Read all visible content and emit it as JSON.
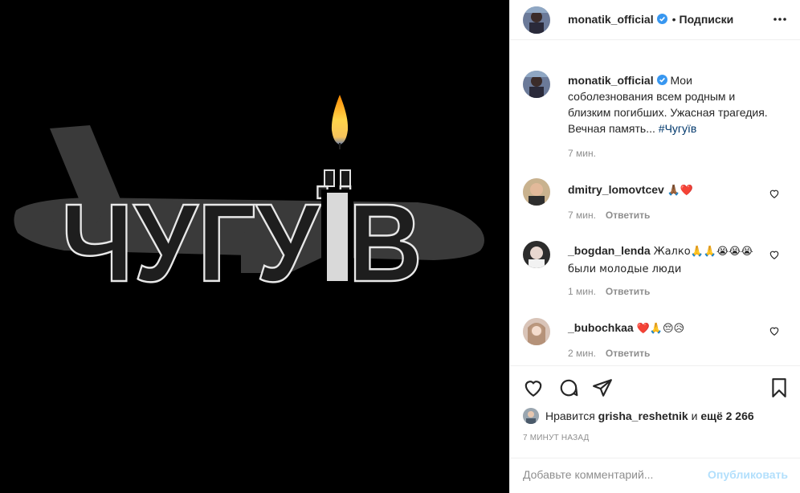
{
  "post": {
    "image_text": "ЧУГУЇВ",
    "author": "monatik_official",
    "follow_dot": "•",
    "follow_label": "Подписки",
    "caption": "Мои соболезнования всем родным и близким погибших. Ужасная трагедия. Вечная память...",
    "caption_hashtag": "#Чугуїв",
    "caption_time": "7 мин."
  },
  "comments": [
    {
      "user": "dmitry_lomovtcev",
      "text": "🙏🏾❤️",
      "time": "7 мин.",
      "reply": "Ответить"
    },
    {
      "user": "_bogdan_lenda",
      "text": "Жалко🙏🙏😭😭😭были молодые люди",
      "time": "1 мин.",
      "reply": "Ответить"
    },
    {
      "user": "_bubochkaa",
      "text": "❤️🙏😔😥",
      "time": "2 мин.",
      "reply": "Ответить"
    }
  ],
  "likes": {
    "prefix": "Нравится",
    "user": "grisha_reshetnik",
    "and": "и",
    "rest": "ещё 2 266"
  },
  "timestamp": "7 МИНУТ НАЗАД",
  "add_comment": {
    "placeholder": "Добавьте комментарий...",
    "publish": "Опубликовать"
  },
  "colors": {
    "verified": "#3897f0",
    "heart": "#ed4956",
    "publish": "#b2dffc"
  }
}
